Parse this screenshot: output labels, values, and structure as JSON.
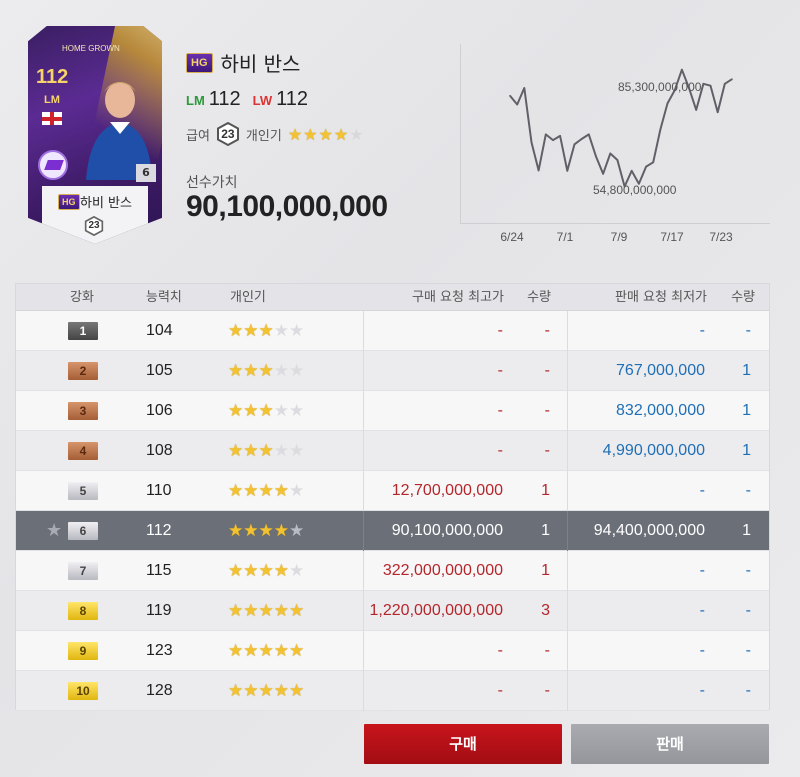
{
  "player": {
    "card_label": "HOME GROWN",
    "card_ovr": "112",
    "card_pos": "LM",
    "card_level": "6",
    "badge": "HG",
    "name": "하비 반스",
    "card_hex": "23",
    "positions": [
      {
        "pos": "LM",
        "ovr": "112",
        "color": "#2c9a3a"
      },
      {
        "pos": "LW",
        "ovr": "112",
        "color": "#dd3333"
      }
    ],
    "salary_label": "급여",
    "salary": "23",
    "popularity_label": "개인기",
    "popularity_stars": 4,
    "value_label": "선수가치",
    "value": "90,100,000,000"
  },
  "chart_data": {
    "type": "line",
    "x_ticks": [
      "6/24",
      "7/1",
      "7/9",
      "7/17",
      "7/23"
    ],
    "annotations": {
      "max": "85,300,000,000",
      "min": "54,800,000,000"
    },
    "values": [
      78.5,
      76.2,
      80.5,
      66.3,
      59.0,
      68.4,
      66.9,
      68.0,
      58.9,
      65.8,
      67.2,
      68.4,
      62.7,
      58.1,
      63.4,
      61.7,
      54.8,
      58.9,
      55.5,
      60.0,
      61.1,
      69.7,
      76.5,
      79.9,
      85.3,
      80.5,
      74.8,
      81.6,
      81.1,
      74.2,
      81.6,
      82.8
    ],
    "ylim": [
      45,
      92
    ],
    "color": "#606068"
  },
  "table": {
    "headers": {
      "grade": "강화",
      "ovr": "능력치",
      "pop": "개인기",
      "buy": "구매 요청 최고가",
      "buy_qty": "수량",
      "sell": "판매 요청 최저가",
      "sell_qty": "수량"
    },
    "rows": [
      {
        "grade": "1",
        "ovr": "104",
        "stars": 3,
        "buy": "-",
        "buy_qty": "-",
        "sell": "-",
        "sell_qty": "-"
      },
      {
        "grade": "2",
        "ovr": "105",
        "stars": 3,
        "buy": "-",
        "buy_qty": "-",
        "sell": "767,000,000",
        "sell_qty": "1"
      },
      {
        "grade": "3",
        "ovr": "106",
        "stars": 3,
        "buy": "-",
        "buy_qty": "-",
        "sell": "832,000,000",
        "sell_qty": "1"
      },
      {
        "grade": "4",
        "ovr": "108",
        "stars": 3,
        "buy": "-",
        "buy_qty": "-",
        "sell": "4,990,000,000",
        "sell_qty": "1"
      },
      {
        "grade": "5",
        "ovr": "110",
        "stars": 4,
        "buy": "12,700,000,000",
        "buy_qty": "1",
        "sell": "-",
        "sell_qty": "-"
      },
      {
        "grade": "6",
        "ovr": "112",
        "stars": 4,
        "buy": "90,100,000,000",
        "buy_qty": "1",
        "sell": "94,400,000,000",
        "sell_qty": "1",
        "current": true
      },
      {
        "grade": "7",
        "ovr": "115",
        "stars": 4,
        "buy": "322,000,000,000",
        "buy_qty": "1",
        "sell": "-",
        "sell_qty": "-"
      },
      {
        "grade": "8",
        "ovr": "119",
        "stars": 5,
        "buy": "1,220,000,000,000",
        "buy_qty": "3",
        "sell": "-",
        "sell_qty": "-"
      },
      {
        "grade": "9",
        "ovr": "123",
        "stars": 5,
        "buy": "-",
        "buy_qty": "-",
        "sell": "-",
        "sell_qty": "-"
      },
      {
        "grade": "10",
        "ovr": "128",
        "stars": 5,
        "buy": "-",
        "buy_qty": "-",
        "sell": "-",
        "sell_qty": "-"
      }
    ]
  },
  "buttons": {
    "buy": "구매",
    "sell": "판매"
  },
  "icons": {
    "current_marker": "star-icon",
    "salary": "hexagon-icon"
  },
  "colors": {
    "buy_text": "#b5262b",
    "sell_text": "#1f6fb5",
    "buy_button": "#b5121a",
    "sell_button": "#9c9ea3",
    "star": "#f2c230"
  }
}
